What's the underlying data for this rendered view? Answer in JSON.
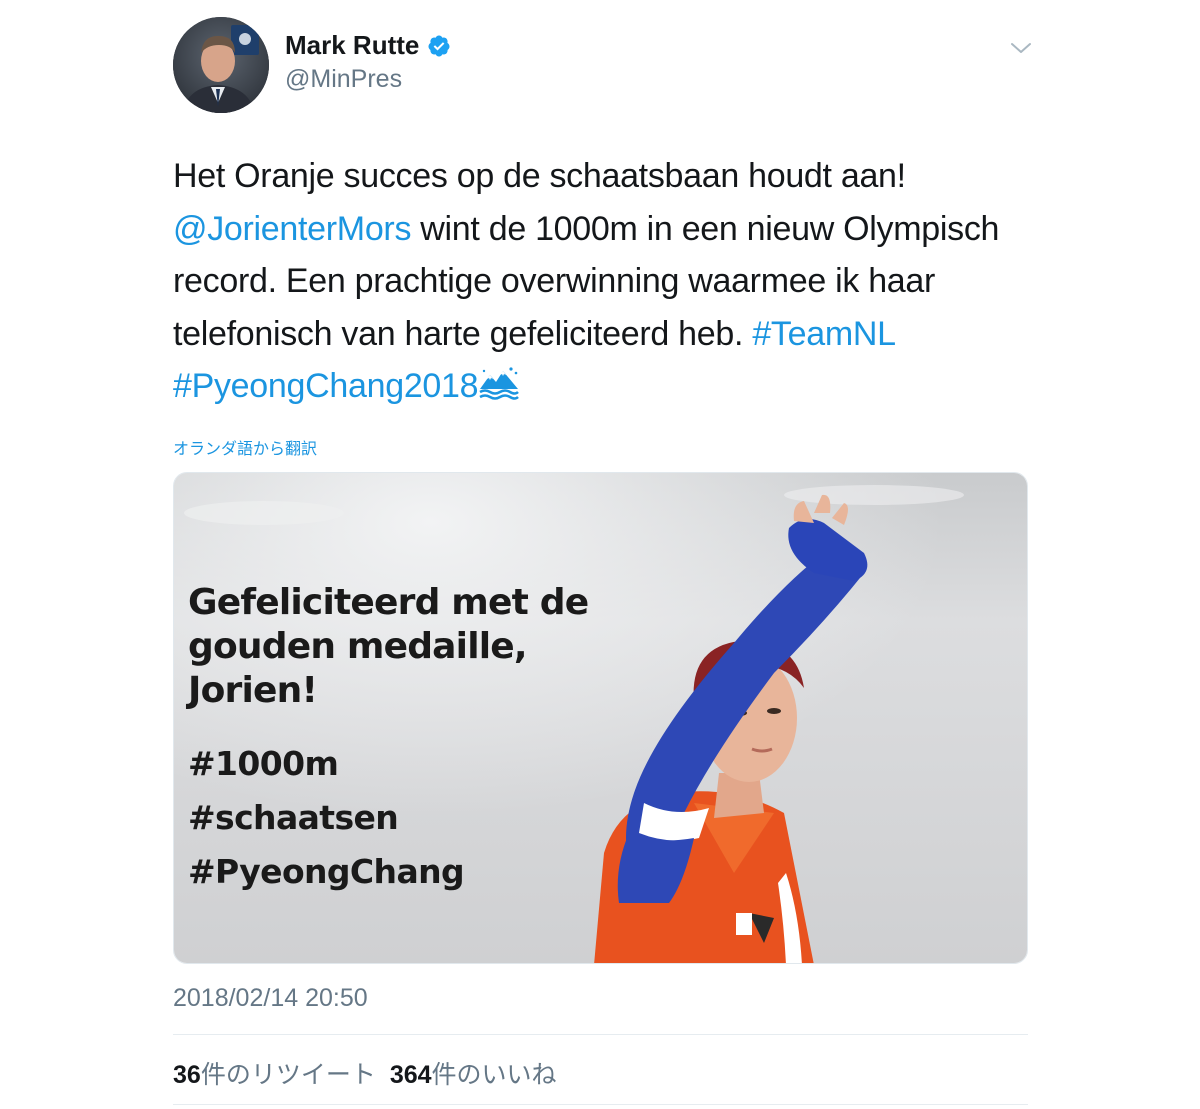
{
  "user": {
    "name": "Mark Rutte",
    "handle": "@MinPres",
    "verified": true,
    "avatar_icon": "profile-photo"
  },
  "tweet": {
    "lines": [
      [
        {
          "text": "Het Oranje succes op de schaatsbaan houdt aan!",
          "link": false
        }
      ],
      [
        {
          "text": "@JorienterMors",
          "link": true
        },
        {
          "text": " wint de 1000m in een nieuw Olympisch",
          "link": false
        }
      ],
      [
        {
          "text": "record. Een prachtige overwinning waarmee ik haar",
          "link": false
        }
      ],
      [
        {
          "text": "telefonisch van harte gefeliciteerd heb. ",
          "link": false
        },
        {
          "text": "#TeamNL",
          "link": true
        }
      ],
      [
        {
          "text": "#PyeongChang2018",
          "link": true
        }
      ]
    ],
    "hashtag_emoji_icon": "pyeongchang-mountain-icon",
    "translate_label": "オランダ語から翻訳",
    "link_color": "#1b95e0"
  },
  "media": {
    "headline": [
      "Gefeliciteerd met de",
      "gouden medaille,",
      "Jorien!"
    ],
    "tags": [
      "#1000m",
      "#schaatsen",
      "#PyeongChang"
    ]
  },
  "footer": {
    "timestamp": "2018/02/14 20:50",
    "retweets_count": "36",
    "retweets_label": "件のリツイート",
    "likes_count": "364",
    "likes_label": "件のいいね"
  }
}
